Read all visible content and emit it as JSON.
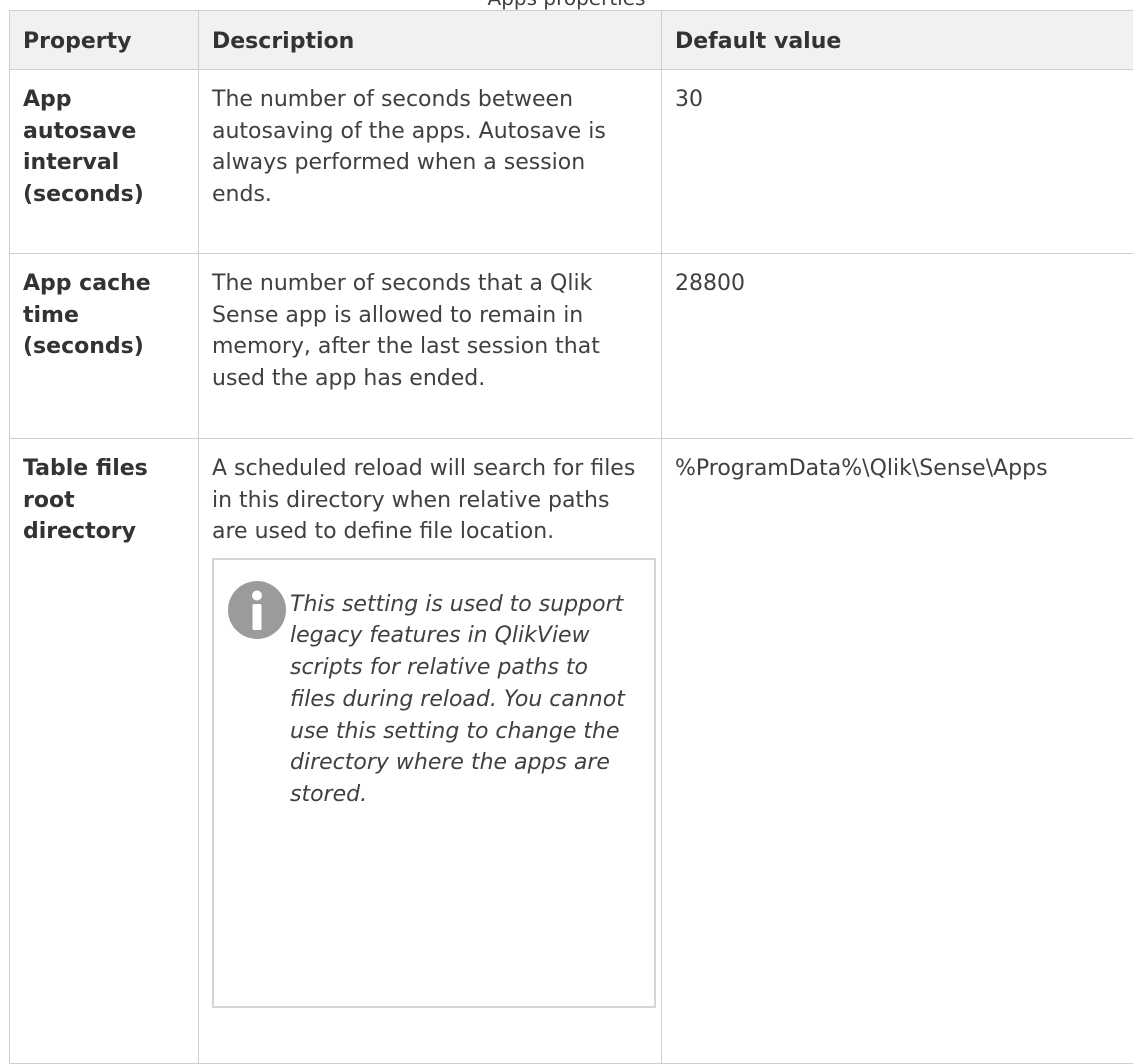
{
  "caption": "Apps properties",
  "table": {
    "headers": [
      "Property",
      "Description",
      "Default value"
    ],
    "rows": [
      {
        "property": "App autosave interval (seconds)",
        "description": "The number of seconds between autosaving of the apps. Autosave is always performed when a session ends.",
        "default": "30"
      },
      {
        "property": "App cache time (seconds)",
        "description": "The number of seconds that a Qlik Sense app is allowed to remain in memory, after the last session that used the app has ended.",
        "default": "28800"
      },
      {
        "property": "Table files root directory",
        "description": "A scheduled reload will search for files in this directory when relative paths are used to define file location.",
        "default": "%ProgramData%\\Qlik\\Sense\\Apps",
        "note": {
          "icon": "info-icon",
          "text": "This setting is used to support legacy features in QlikView scripts for relative paths to files during reload. You cannot use this setting to change the directory where the apps are stored."
        }
      }
    ]
  },
  "colors": {
    "header_bg": "#f1f1f1",
    "border": "#cfcfcf",
    "note_border": "#d6d6d6",
    "icon": "#9b9b9b",
    "text": "#404040"
  }
}
